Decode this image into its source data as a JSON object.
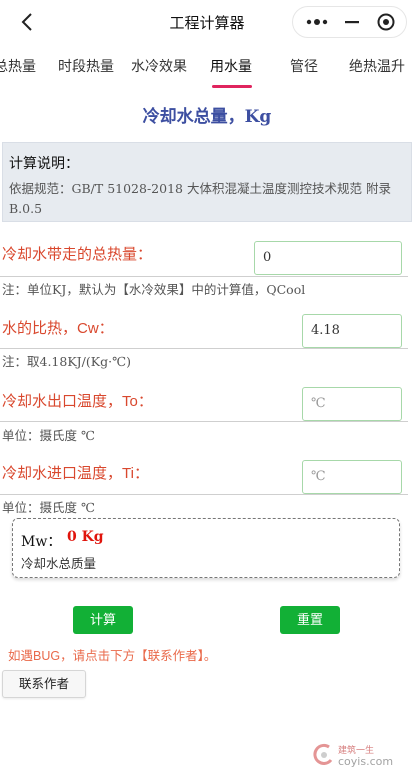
{
  "nav": {
    "title": "工程计算器"
  },
  "tabs": [
    {
      "label": "总热量"
    },
    {
      "label": "时段热量"
    },
    {
      "label": "水冷效果"
    },
    {
      "label": "用水量"
    },
    {
      "label": "管径"
    },
    {
      "label": "绝热温升"
    }
  ],
  "active_tab": "用水量",
  "page_title": "冷却水总量，Kg",
  "info": {
    "title": "计算说明：",
    "text": "依据规范：GB/T 51028-2018 大体积混凝土温度测控技术规范 附录B.0.5"
  },
  "fields": [
    {
      "label": "冷却水带走的总热量：",
      "value": "0",
      "note": "注：单位KJ，默认为【水冷效果】中的计算值，QCool"
    },
    {
      "label": "水的比热，Cw：",
      "value": "4.18",
      "note": "注：取4.18KJ/(Kg·℃)"
    },
    {
      "label": "冷却水出口温度，To：",
      "placeholder": "℃",
      "note": "单位：摄氏度 ℃"
    },
    {
      "label": "冷却水进口温度，Ti：",
      "placeholder": "℃",
      "note": "单位：摄氏度 ℃"
    }
  ],
  "result": {
    "symbol": "Mw：",
    "value": "0 Kg",
    "desc": "冷却水总质量"
  },
  "buttons": {
    "calc": "计算",
    "reset": "重置",
    "contact": "联系作者"
  },
  "bug_text": "如遇BUG，请点击下方【联系作者】。",
  "watermark": {
    "line1": "建筑一生",
    "line2": "coyis.com"
  },
  "colors": {
    "label_red": "#d9482e",
    "title_blue": "#3d4fa1",
    "accent_pink": "#e0245e",
    "button_green": "#12b036",
    "result_red": "#e0140c"
  }
}
